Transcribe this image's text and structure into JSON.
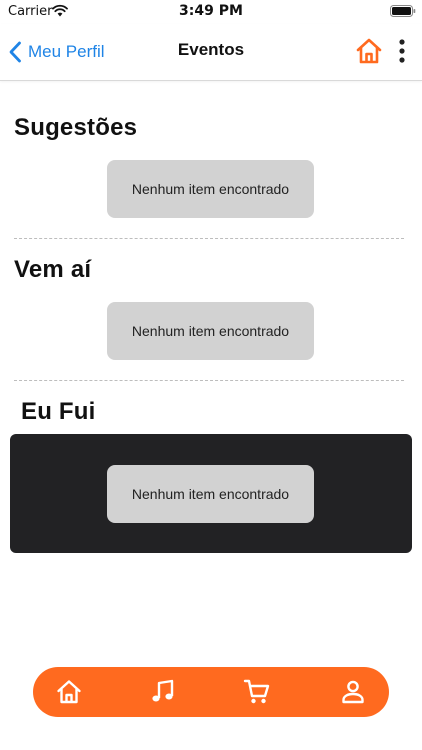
{
  "status_bar": {
    "carrier": "Carrier",
    "time": "3:49 PM",
    "wifi_icon": "wifi-icon",
    "battery_icon": "battery-icon"
  },
  "nav": {
    "back_label": "Meu Perfil",
    "title": "Eventos",
    "home_icon": "home-icon",
    "more_icon": "more-vertical-icon"
  },
  "sections": [
    {
      "title": "Sugestões",
      "empty_text": "Nenhum item encontrado"
    },
    {
      "title": "Vem aí",
      "empty_text": "Nenhum item encontrado"
    },
    {
      "title": "Eu Fui",
      "empty_text": "Nenhum item encontrado"
    }
  ],
  "tab_bar": {
    "items": [
      {
        "icon": "home-icon"
      },
      {
        "icon": "music-icon"
      },
      {
        "icon": "cart-icon"
      },
      {
        "icon": "user-icon"
      }
    ]
  },
  "colors": {
    "accent": "#ff6a1f",
    "link": "#1f84e6",
    "pill": "#d2d2d2",
    "panel_dark": "#222224"
  }
}
